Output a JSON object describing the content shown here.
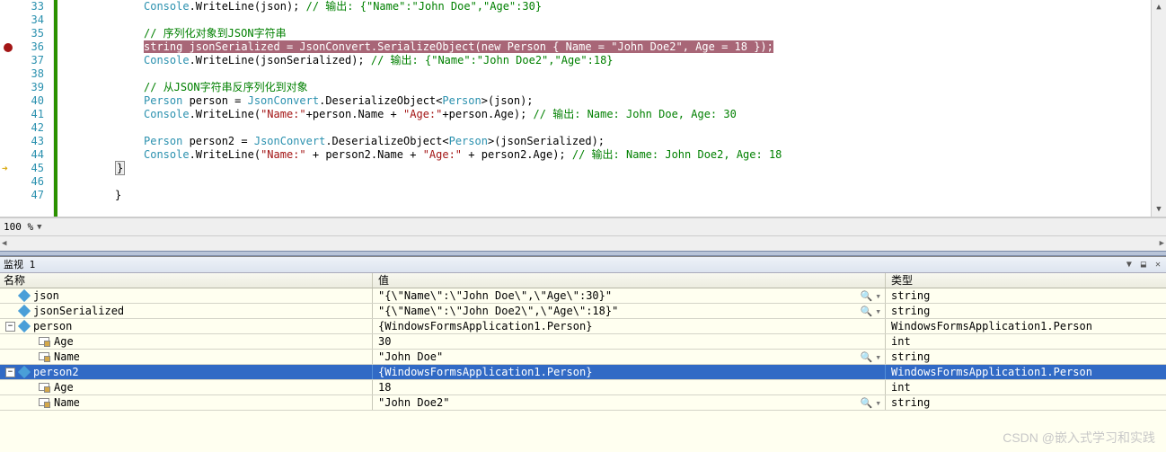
{
  "zoom": "100 %",
  "gutter_start": 33,
  "breakpoint_line": 36,
  "exec_line": 45,
  "code_lines": [
    {
      "n": 33,
      "indent": 3,
      "tokens": [
        {
          "t": "Console",
          "c": "type"
        },
        {
          "t": ".WriteLine(json); ",
          "c": "ident"
        },
        {
          "t": "// 输出: {\"Name\":\"John Doe\",\"Age\":30}",
          "c": "comment"
        }
      ]
    },
    {
      "n": 34,
      "indent": 3,
      "tokens": []
    },
    {
      "n": 35,
      "indent": 3,
      "tokens": [
        {
          "t": "// 序列化对象到JSON字符串",
          "c": "comment"
        }
      ]
    },
    {
      "n": 36,
      "indent": 3,
      "hl": true,
      "tokens": [
        {
          "t": "string",
          "c": "kw"
        },
        {
          "t": " jsonSerialized = ",
          "c": "ident"
        },
        {
          "t": "JsonConvert",
          "c": "type"
        },
        {
          "t": ".SerializeObject(",
          "c": "ident"
        },
        {
          "t": "new",
          "c": "kw"
        },
        {
          "t": " ",
          "c": "ident"
        },
        {
          "t": "Person",
          "c": "type"
        },
        {
          "t": " { Name = ",
          "c": "ident"
        },
        {
          "t": "\"John Doe2\"",
          "c": "str"
        },
        {
          "t": ", Age = 18 });",
          "c": "ident"
        }
      ]
    },
    {
      "n": 37,
      "indent": 3,
      "tokens": [
        {
          "t": "Console",
          "c": "type"
        },
        {
          "t": ".WriteLine(jsonSerialized); ",
          "c": "ident"
        },
        {
          "t": "// 输出: {\"Name\":\"John Doe2\",\"Age\":18}",
          "c": "comment"
        }
      ]
    },
    {
      "n": 38,
      "indent": 3,
      "tokens": []
    },
    {
      "n": 39,
      "indent": 3,
      "tokens": [
        {
          "t": "// 从JSON字符串反序列化到对象",
          "c": "comment"
        }
      ]
    },
    {
      "n": 40,
      "indent": 3,
      "tokens": [
        {
          "t": "Person",
          "c": "type"
        },
        {
          "t": " person = ",
          "c": "ident"
        },
        {
          "t": "JsonConvert",
          "c": "type"
        },
        {
          "t": ".DeserializeObject<",
          "c": "ident"
        },
        {
          "t": "Person",
          "c": "type"
        },
        {
          "t": ">(json);",
          "c": "ident"
        }
      ]
    },
    {
      "n": 41,
      "indent": 3,
      "tokens": [
        {
          "t": "Console",
          "c": "type"
        },
        {
          "t": ".WriteLine(",
          "c": "ident"
        },
        {
          "t": "\"Name:\"",
          "c": "str"
        },
        {
          "t": "+person.Name + ",
          "c": "ident"
        },
        {
          "t": "\"Age:\"",
          "c": "str"
        },
        {
          "t": "+person.Age); ",
          "c": "ident"
        },
        {
          "t": "// 输出: Name: John Doe, Age: 30",
          "c": "comment"
        }
      ]
    },
    {
      "n": 42,
      "indent": 3,
      "tokens": []
    },
    {
      "n": 43,
      "indent": 3,
      "tokens": [
        {
          "t": "Person",
          "c": "type"
        },
        {
          "t": " person2 = ",
          "c": "ident"
        },
        {
          "t": "JsonConvert",
          "c": "type"
        },
        {
          "t": ".DeserializeObject<",
          "c": "ident"
        },
        {
          "t": "Person",
          "c": "type"
        },
        {
          "t": ">(jsonSerialized);",
          "c": "ident"
        }
      ]
    },
    {
      "n": 44,
      "indent": 3,
      "tokens": [
        {
          "t": "Console",
          "c": "type"
        },
        {
          "t": ".WriteLine(",
          "c": "ident"
        },
        {
          "t": "\"Name:\"",
          "c": "str"
        },
        {
          "t": " + person2.Name + ",
          "c": "ident"
        },
        {
          "t": "\"Age:\"",
          "c": "str"
        },
        {
          "t": " + person2.Age); ",
          "c": "ident"
        },
        {
          "t": "// 输出: Name: John Doe2, Age: 18",
          "c": "comment"
        }
      ]
    },
    {
      "n": 45,
      "indent": 2,
      "brace": true,
      "tokens": [
        {
          "t": "}",
          "c": "ident"
        }
      ]
    },
    {
      "n": 46,
      "indent": 2,
      "tokens": []
    },
    {
      "n": 47,
      "indent": 2,
      "tokens": [
        {
          "t": "}",
          "c": "ident"
        }
      ]
    }
  ],
  "watch": {
    "title": "监视 1",
    "headers": {
      "name": "名称",
      "value": "值",
      "type": "类型"
    },
    "rows": [
      {
        "depth": 0,
        "expand": "none",
        "icon": "diamond",
        "name": "json",
        "value": "\"{\\\"Name\\\":\\\"John Doe\\\",\\\"Age\\\":30}\"",
        "type": "string",
        "refresh": true
      },
      {
        "depth": 0,
        "expand": "none",
        "icon": "diamond",
        "name": "jsonSerialized",
        "value": "\"{\\\"Name\\\":\\\"John Doe2\\\",\\\"Age\\\":18}\"",
        "type": "string",
        "refresh": true
      },
      {
        "depth": 0,
        "expand": "minus",
        "icon": "diamond",
        "name": "person",
        "value": "{WindowsFormsApplication1.Person}",
        "type": "WindowsFormsApplication1.Person"
      },
      {
        "depth": 1,
        "expand": "none",
        "icon": "prop",
        "name": "Age",
        "value": "30",
        "type": "int"
      },
      {
        "depth": 1,
        "expand": "none",
        "icon": "prop",
        "name": "Name",
        "value": "\"John Doe\"",
        "type": "string",
        "refresh": true
      },
      {
        "depth": 0,
        "expand": "minus",
        "icon": "diamond",
        "name": "person2",
        "value": "{WindowsFormsApplication1.Person}",
        "type": "WindowsFormsApplication1.Person",
        "selected": true
      },
      {
        "depth": 1,
        "expand": "none",
        "icon": "prop",
        "name": "Age",
        "value": "18",
        "type": "int"
      },
      {
        "depth": 1,
        "expand": "none",
        "icon": "prop",
        "name": "Name",
        "value": "\"John Doe2\"",
        "type": "string",
        "refresh": true
      }
    ]
  },
  "watermark": "CSDN @嵌入式学习和实践"
}
